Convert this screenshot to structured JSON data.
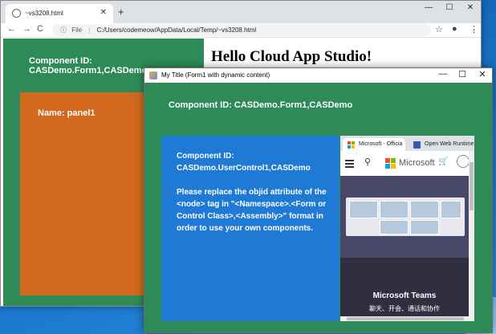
{
  "browser": {
    "tab_title": "~vs3208.html",
    "new_tab": "+",
    "url_scheme": "File",
    "url": "C:/Users/codemeow/AppData/Local/Temp/~vs3208.html",
    "controls": {
      "minimize": "—",
      "maximize": "☐",
      "close": "✕"
    },
    "nav": {
      "back": "←",
      "forward": "→",
      "reload": "C",
      "info": "ⓘ"
    },
    "toolbar_icons": {
      "star": "☆",
      "profile": "●",
      "menu": "⋮"
    }
  },
  "page": {
    "heading": "Hello Cloud App Studio!",
    "form_component_id": "Component ID: CASDemo.Form1,CASDemo",
    "panel_label": "Name: panel1"
  },
  "popup": {
    "title": "My Title (Form1 with dynamic content)",
    "controls": {
      "minimize": "—",
      "maximize": "☐",
      "close": "✕"
    },
    "form_component_id": "Component ID: CASDemo.Form1,CASDemo",
    "user_control": {
      "component_id_line1": "Component ID:",
      "component_id_line2": "CASDemo.UserControl1,CASDemo",
      "message": "Please replace the objid attribute of the <node> tag in \"<Namespace>.<Form or Control Class>,<Assembly>\" format in order to use your own components."
    },
    "embedded_browser": {
      "tabs": [
        "Microsoft - Officia",
        "Open Web Runtime"
      ],
      "brand": "Microsoft",
      "search_icon": "⚲",
      "cart_icon": "🛒",
      "hero_title": "Microsoft Teams",
      "hero_subtitle": "聊天、开会、通话和协作"
    }
  },
  "colors": {
    "form_green": "#2e8b57",
    "panel_orange": "#d2691e",
    "user_control_blue": "#1e7ad4"
  }
}
